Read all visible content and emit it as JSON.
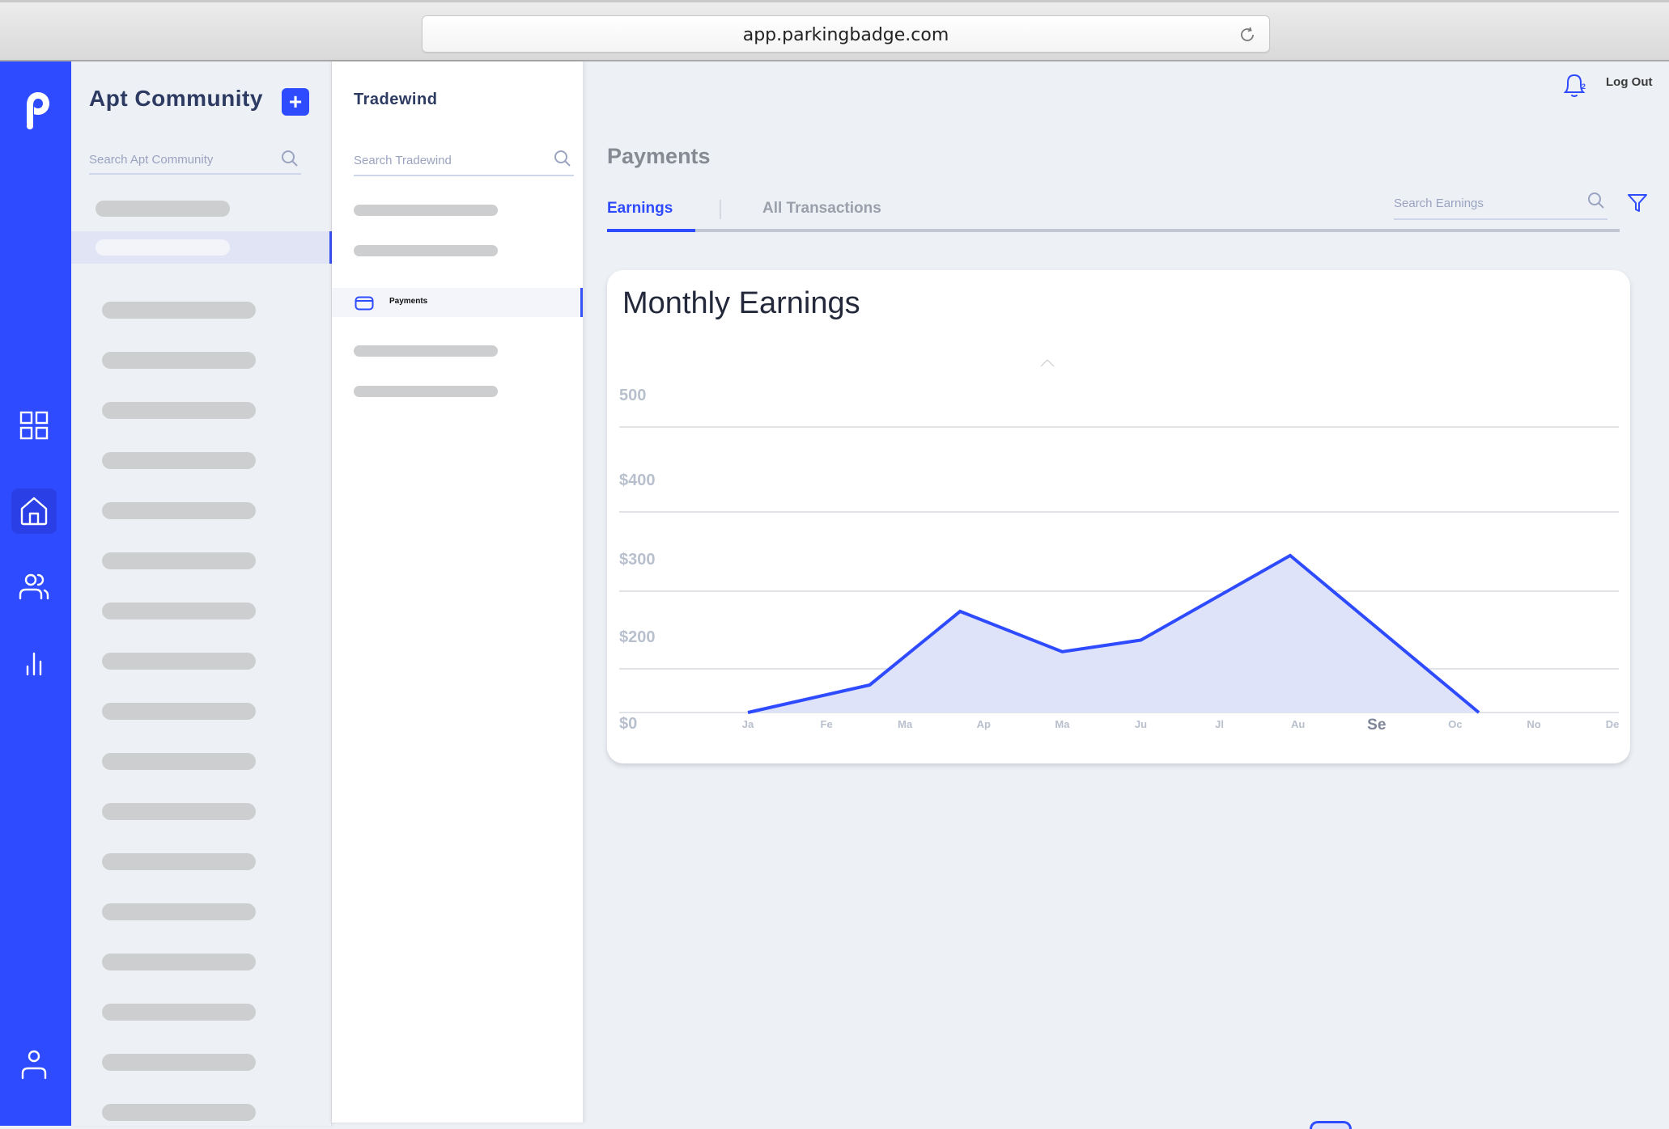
{
  "browser": {
    "url": "app.parkingbadge.com"
  },
  "rail": {
    "items": [
      {
        "name": "dashboard",
        "icon": "grid-icon",
        "active": false
      },
      {
        "name": "home",
        "icon": "home-icon",
        "active": true
      },
      {
        "name": "users",
        "icon": "users-icon",
        "active": false
      },
      {
        "name": "analytics",
        "icon": "bar-chart-icon",
        "active": false
      }
    ],
    "profile_icon": "user-icon",
    "logo_icon": "parkingbadge-logo"
  },
  "community_panel": {
    "title": "Apt Community",
    "add_label": "+",
    "search_placeholder": "Search Apt Community",
    "selected_index": 1,
    "item_count": 18
  },
  "tradewind_panel": {
    "title": "Tradewind",
    "search_placeholder": "Search Tradewind",
    "active_item": "Payments"
  },
  "header": {
    "notifications_count": "2",
    "logout_label": "Log Out"
  },
  "main": {
    "page_title": "Payments",
    "tabs": [
      {
        "label": "Earnings",
        "active": true
      },
      {
        "label": "All Transactions",
        "active": false
      }
    ],
    "search_placeholder": "Search Earnings"
  },
  "colors": {
    "brand": "#2e4bff",
    "area_fill": "#dfe3fa",
    "gridline": "#e2e3e6",
    "axis_label": "#b8bfcd"
  },
  "chart_data": {
    "type": "area",
    "title": "Monthly Earnings",
    "xlabel": "",
    "ylabel": "",
    "categories": [
      "Ja",
      "Fe",
      "Ma",
      "Ap",
      "Ma",
      "Ju",
      "Jl",
      "Au",
      "Se",
      "Oc",
      "No",
      "De"
    ],
    "highlighted_category": "Se",
    "y_ticks": [
      {
        "value": 0,
        "label": "$0"
      },
      {
        "value": 200,
        "label": "$200"
      },
      {
        "value": 300,
        "label": "$300"
      },
      {
        "value": 400,
        "label": "$400"
      },
      {
        "value": 500,
        "label": "500"
      }
    ],
    "ylim": [
      0,
      500
    ],
    "grid": true,
    "legend": "none",
    "series": [
      {
        "name": "Earnings",
        "points": [
          {
            "x": 0.0,
            "y": 0
          },
          {
            "x": 1.55,
            "y": 126
          },
          {
            "x": 2.7,
            "y": 274
          },
          {
            "x": 4.0,
            "y": 222
          },
          {
            "x": 5.0,
            "y": 237
          },
          {
            "x": 6.9,
            "y": 345
          },
          {
            "x": 9.3,
            "y": 0
          }
        ]
      }
    ]
  }
}
